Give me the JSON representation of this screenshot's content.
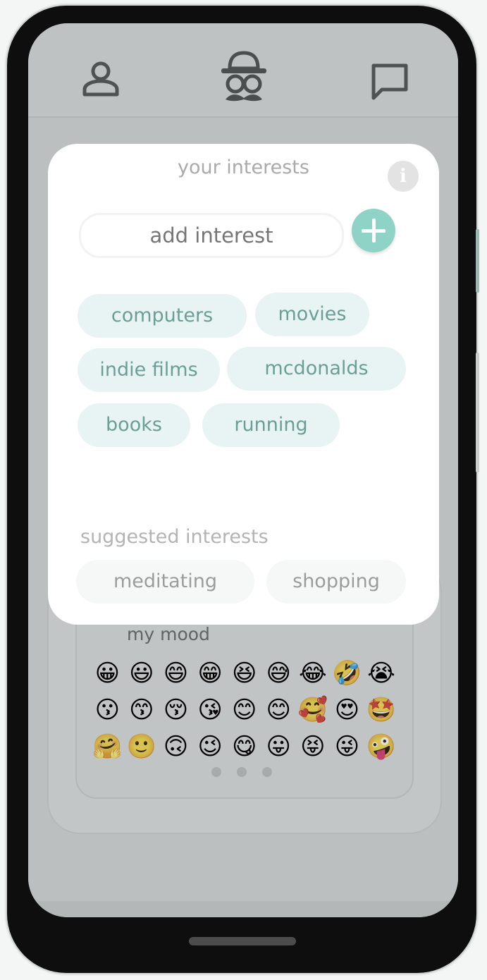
{
  "header": {
    "profile_icon": "person-icon",
    "logo_icon": "detective-logo-icon",
    "chat_icon": "chat-bubble-icon"
  },
  "modal": {
    "title": "your interests",
    "info_icon_label": "i",
    "input_placeholder": "add interest",
    "add_icon": "plus-icon",
    "interests": [
      "computers",
      "movies",
      "indie films",
      "mcdonalds",
      "books",
      "running"
    ],
    "suggested_title": "suggested interests",
    "suggested": [
      "meditating",
      "shopping"
    ]
  },
  "mood": {
    "title": "my mood",
    "emojis": [
      "😀",
      "😃",
      "😄",
      "😁",
      "😆",
      "😅",
      "😂",
      "🤣",
      "😭",
      "😗",
      "😙",
      "😚",
      "😘",
      "😊",
      "😊",
      "🥰",
      "😍",
      "🤩",
      "🤗",
      "🙂",
      "🙃",
      "😉",
      "😋",
      "😛",
      "😝",
      "😜",
      "🤪"
    ],
    "page_count": 3
  },
  "colors": {
    "accent": "#8ed3c6",
    "chip_bg": "#e7f4f3",
    "chip_text": "#6a9e96",
    "overlay": "#bfc2c2"
  }
}
